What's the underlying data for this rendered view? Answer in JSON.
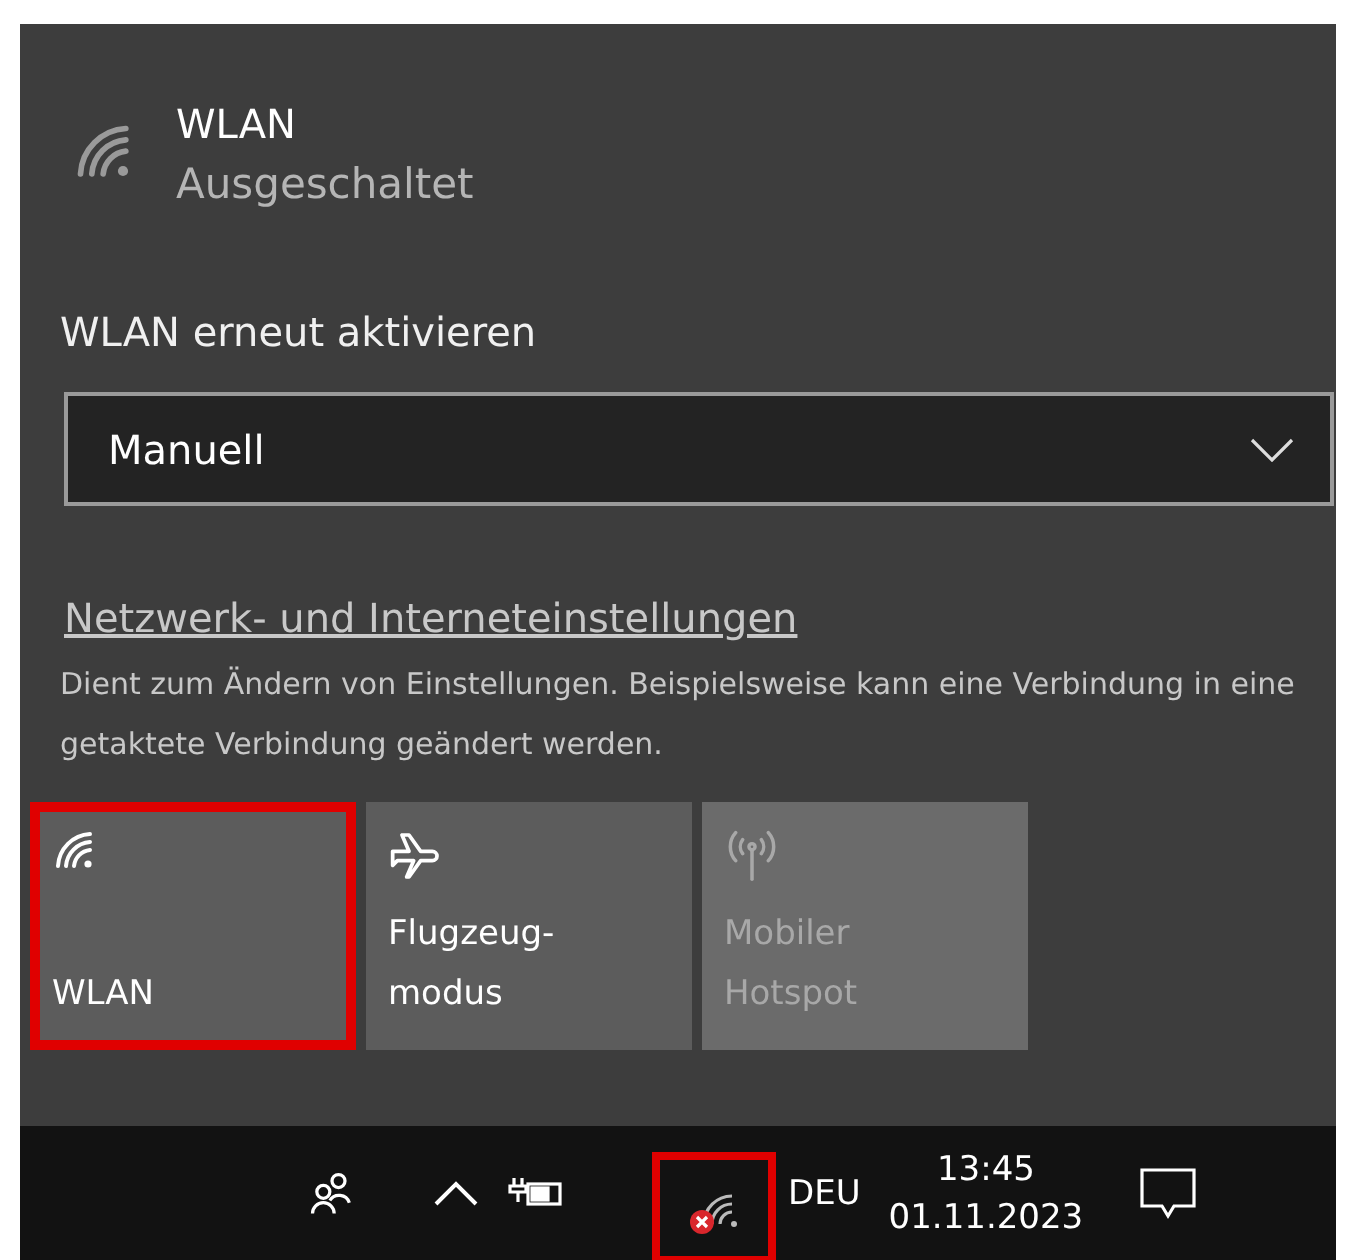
{
  "network": {
    "title": "WLAN",
    "status": "Ausgeschaltet"
  },
  "reactivate": {
    "label": "WLAN erneut aktivieren",
    "value": "Manuell"
  },
  "settings_link": {
    "label": "Netzwerk- und Interneteinstellungen",
    "description": "Dient zum Ändern von Einstellungen. Beispielsweise kann eine Verbindung in eine getaktete Verbindung geändert werden."
  },
  "tiles": [
    {
      "kind": "wifi",
      "lines": [
        "WLAN"
      ],
      "disabled": false,
      "highlighted": true
    },
    {
      "kind": "airplane",
      "lines": [
        "Flugzeug-",
        "modus"
      ],
      "disabled": false,
      "highlighted": false
    },
    {
      "kind": "hotspot",
      "lines": [
        "Mobiler",
        "Hotspot"
      ],
      "disabled": true,
      "highlighted": false
    }
  ],
  "taskbar": {
    "language": "DEU",
    "time": "13:45",
    "date": "01.11.2023",
    "network_highlighted": true
  }
}
